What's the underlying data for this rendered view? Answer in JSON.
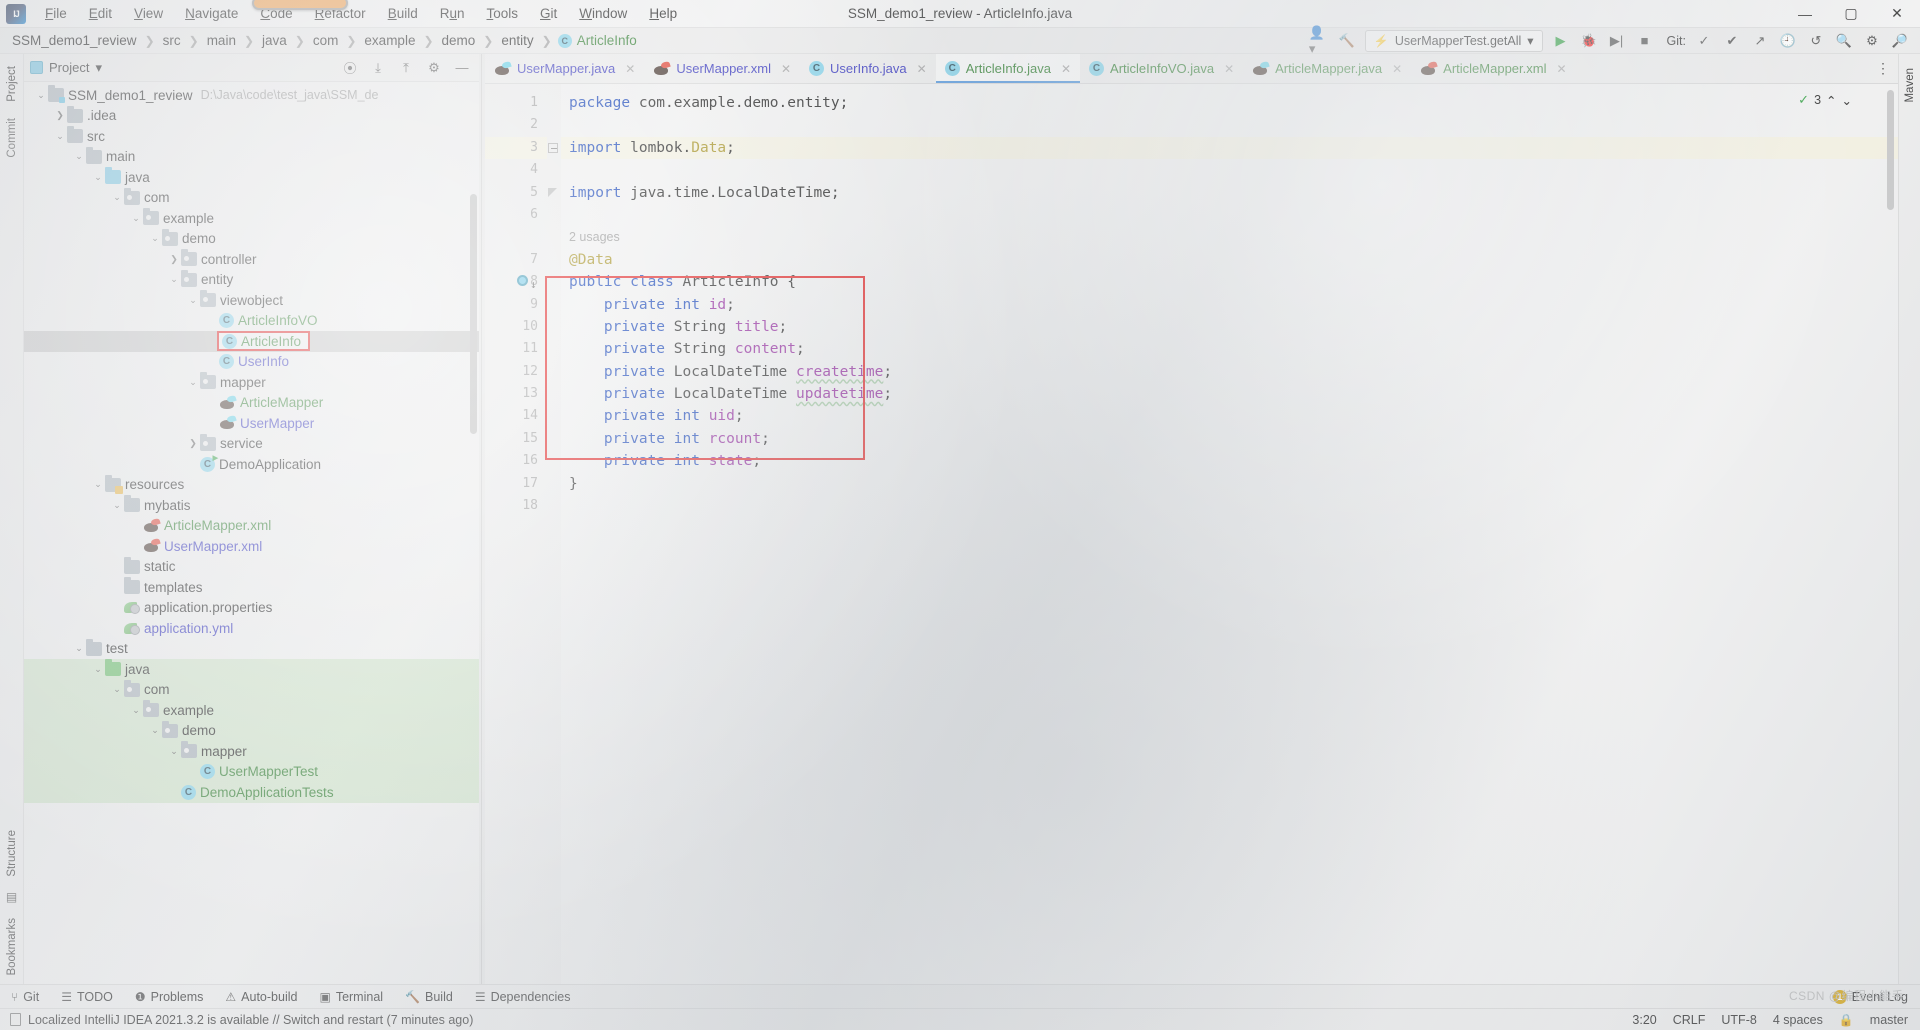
{
  "window": {
    "title": "SSM_demo1_review - ArticleInfo.java",
    "logo_text": "IJ",
    "minimize": "—",
    "maximize": "▢",
    "close": "✕"
  },
  "menu": [
    {
      "label": "File",
      "mnemonic": "F"
    },
    {
      "label": "Edit",
      "mnemonic": "E"
    },
    {
      "label": "View",
      "mnemonic": "V"
    },
    {
      "label": "Navigate",
      "mnemonic": "N"
    },
    {
      "label": "Code",
      "mnemonic": "C"
    },
    {
      "label": "Refactor",
      "mnemonic": "R"
    },
    {
      "label": "Build",
      "mnemonic": "B"
    },
    {
      "label": "Run",
      "mnemonic": "u"
    },
    {
      "label": "Tools",
      "mnemonic": "T"
    },
    {
      "label": "Git",
      "mnemonic": "G"
    },
    {
      "label": "Window",
      "mnemonic": "W"
    },
    {
      "label": "Help",
      "mnemonic": "H"
    }
  ],
  "breadcrumb": {
    "items": [
      "SSM_demo1_review",
      "src",
      "main",
      "java",
      "com",
      "example",
      "demo",
      "entity"
    ],
    "file": "ArticleInfo",
    "separator": "❯"
  },
  "navbar_right": {
    "run_config": "UserMapperTest.getAll",
    "git_label": "Git:",
    "icons": [
      "account-icon",
      "hammer-icon",
      "run-icon",
      "debug-icon",
      "coverage-icon",
      "stop-icon",
      "commit-icon",
      "update-icon",
      "push-icon",
      "history-icon",
      "undo-icon",
      "search-icon",
      "settings-icon",
      "ide-search-icon"
    ]
  },
  "left_rail": {
    "top_tab": "Project",
    "tabs": [
      "Commit",
      "Structure",
      "Bookmarks"
    ]
  },
  "right_rail": {
    "tabs": [
      "Maven"
    ]
  },
  "project_panel": {
    "title": "Project",
    "dropdown": "▾",
    "header_icons": [
      "locate-icon",
      "expand-all-icon",
      "collapse-all-icon",
      "settings-icon",
      "hide-icon"
    ],
    "tree": [
      {
        "depth": 0,
        "arrow": "v",
        "icon": "folder-src",
        "label": "SSM_demo1_review",
        "sub": "D:\\Java\\code\\test_java\\SSM_de",
        "color": "dark",
        "state": "normal"
      },
      {
        "depth": 1,
        "arrow": ">",
        "icon": "folder",
        "label": ".idea",
        "color": "dark",
        "state": "normal"
      },
      {
        "depth": 1,
        "arrow": "v",
        "icon": "folder",
        "label": "src",
        "color": "dark",
        "state": "normal"
      },
      {
        "depth": 2,
        "arrow": "v",
        "icon": "folder",
        "label": "main",
        "color": "dark",
        "state": "normal"
      },
      {
        "depth": 3,
        "arrow": "v",
        "icon": "folder-blue",
        "label": "java",
        "color": "dark",
        "state": "normal"
      },
      {
        "depth": 4,
        "arrow": "v",
        "icon": "folder-pkg",
        "label": "com",
        "color": "dark",
        "state": "normal"
      },
      {
        "depth": 5,
        "arrow": "v",
        "icon": "folder-pkg",
        "label": "example",
        "color": "dark",
        "state": "normal"
      },
      {
        "depth": 6,
        "arrow": "v",
        "icon": "folder-pkg",
        "label": "demo",
        "color": "dark",
        "state": "normal"
      },
      {
        "depth": 7,
        "arrow": ">",
        "icon": "folder-pkg",
        "label": "controller",
        "color": "dark",
        "state": "normal"
      },
      {
        "depth": 7,
        "arrow": "v",
        "icon": "folder-pkg",
        "label": "entity",
        "color": "dark",
        "state": "normal"
      },
      {
        "depth": 8,
        "arrow": "v",
        "icon": "folder-pkg",
        "label": "viewobject",
        "color": "dark",
        "state": "normal"
      },
      {
        "depth": 9,
        "arrow": "",
        "icon": "class",
        "label": "ArticleInfoVO",
        "color": "green",
        "state": "normal"
      },
      {
        "depth": 9,
        "arrow": "",
        "icon": "class",
        "label": "ArticleInfo",
        "color": "green",
        "state": "selected-redbox"
      },
      {
        "depth": 9,
        "arrow": "",
        "icon": "class",
        "label": "UserInfo",
        "color": "blue",
        "state": "normal"
      },
      {
        "depth": 8,
        "arrow": "v",
        "icon": "folder-pkg",
        "label": "mapper",
        "color": "dark",
        "state": "normal"
      },
      {
        "depth": 9,
        "arrow": "",
        "icon": "mybatis",
        "label": "ArticleMapper",
        "color": "green",
        "state": "normal"
      },
      {
        "depth": 9,
        "arrow": "",
        "icon": "mybatis",
        "label": "UserMapper",
        "color": "blue",
        "state": "normal"
      },
      {
        "depth": 8,
        "arrow": ">",
        "icon": "folder-pkg",
        "label": "service",
        "color": "dark",
        "state": "normal"
      },
      {
        "depth": 8,
        "arrow": "",
        "icon": "class-spring",
        "label": "DemoApplication",
        "color": "dark",
        "state": "normal"
      },
      {
        "depth": 3,
        "arrow": "v",
        "icon": "folder-res",
        "label": "resources",
        "color": "dark",
        "state": "normal"
      },
      {
        "depth": 4,
        "arrow": "v",
        "icon": "folder",
        "label": "mybatis",
        "color": "dark",
        "state": "normal"
      },
      {
        "depth": 5,
        "arrow": "",
        "icon": "mybatis-red",
        "label": "ArticleMapper.xml",
        "color": "green",
        "state": "normal"
      },
      {
        "depth": 5,
        "arrow": "",
        "icon": "mybatis-red",
        "label": "UserMapper.xml",
        "color": "blue",
        "state": "normal"
      },
      {
        "depth": 4,
        "arrow": "",
        "icon": "folder",
        "label": "static",
        "color": "dark",
        "state": "normal"
      },
      {
        "depth": 4,
        "arrow": "",
        "icon": "folder",
        "label": "templates",
        "color": "dark",
        "state": "normal"
      },
      {
        "depth": 4,
        "arrow": "",
        "icon": "leaf",
        "label": "application.properties",
        "color": "dark",
        "state": "normal"
      },
      {
        "depth": 4,
        "arrow": "",
        "icon": "leaf",
        "label": "application.yml",
        "color": "blue",
        "state": "normal"
      },
      {
        "depth": 2,
        "arrow": "v",
        "icon": "folder",
        "label": "test",
        "color": "dark",
        "state": "normal"
      },
      {
        "depth": 3,
        "arrow": "v",
        "icon": "folder-green",
        "label": "java",
        "color": "dark",
        "state": "test-highlight"
      },
      {
        "depth": 4,
        "arrow": "v",
        "icon": "folder-pkg",
        "label": "com",
        "color": "dark",
        "state": "test-highlight"
      },
      {
        "depth": 5,
        "arrow": "v",
        "icon": "folder-pkg",
        "label": "example",
        "color": "dark",
        "state": "test-highlight"
      },
      {
        "depth": 6,
        "arrow": "v",
        "icon": "folder-pkg",
        "label": "demo",
        "color": "dark",
        "state": "test-highlight"
      },
      {
        "depth": 7,
        "arrow": "v",
        "icon": "folder-pkg",
        "label": "mapper",
        "color": "dark",
        "state": "test-highlight"
      },
      {
        "depth": 8,
        "arrow": "",
        "icon": "class",
        "label": "UserMapperTest",
        "color": "green",
        "state": "test-highlight"
      },
      {
        "depth": 7,
        "arrow": "",
        "icon": "class",
        "label": "DemoApplicationTests",
        "color": "green",
        "state": "test-highlight"
      }
    ]
  },
  "editor": {
    "tabs": [
      {
        "label": "UserMapper.java",
        "icon": "mybatis",
        "color": "blue",
        "active": false
      },
      {
        "label": "UserMapper.xml",
        "icon": "mybatis-red",
        "color": "blue",
        "active": false
      },
      {
        "label": "UserInfo.java",
        "icon": "class",
        "color": "blue",
        "active": false
      },
      {
        "label": "ArticleInfo.java",
        "icon": "class",
        "color": "green",
        "active": true
      },
      {
        "label": "ArticleInfoVO.java",
        "icon": "class",
        "color": "green",
        "active": false
      },
      {
        "label": "ArticleMapper.java",
        "icon": "mybatis",
        "color": "green",
        "active": false
      },
      {
        "label": "ArticleMapper.xml",
        "icon": "mybatis-red",
        "color": "green",
        "active": false
      }
    ],
    "tab_close": "✕",
    "more_tabs": "⋮",
    "inspection_count": "3",
    "inspection_ok": "✓",
    "lines": [
      {
        "n": "1",
        "text": "package com.example.demo.entity;",
        "type": "package"
      },
      {
        "n": "2",
        "text": "",
        "type": "blank"
      },
      {
        "n": "3",
        "text": "import lombok.Data;",
        "type": "import-lombok",
        "highlight": true,
        "fold": "minus"
      },
      {
        "n": "4",
        "text": "",
        "type": "blank"
      },
      {
        "n": "5",
        "text": "import java.time.LocalDateTime;",
        "type": "import-plain",
        "fold": "tri"
      },
      {
        "n": "6",
        "text": "",
        "type": "blank"
      },
      {
        "n": "",
        "text": "2 usages",
        "type": "usages"
      },
      {
        "n": "7",
        "text": "@Data",
        "type": "annotation"
      },
      {
        "n": "8",
        "text": "public class ArticleInfo {",
        "type": "classdecl",
        "breakpoint": true
      },
      {
        "n": "9",
        "text": "    private int id;",
        "type": "field",
        "mods": "private",
        "ftype": "int",
        "fname": "id"
      },
      {
        "n": "10",
        "text": "    private String title;",
        "type": "field",
        "mods": "private",
        "ftype": "String",
        "fname": "title"
      },
      {
        "n": "11",
        "text": "    private String content;",
        "type": "field",
        "mods": "private",
        "ftype": "String",
        "fname": "content"
      },
      {
        "n": "12",
        "text": "    private LocalDateTime createtime;",
        "type": "field-wavy",
        "mods": "private",
        "ftype": "LocalDateTime",
        "fname": "createtime"
      },
      {
        "n": "13",
        "text": "    private LocalDateTime updatetime;",
        "type": "field-wavy",
        "mods": "private",
        "ftype": "LocalDateTime",
        "fname": "updatetime"
      },
      {
        "n": "14",
        "text": "    private int uid;",
        "type": "field",
        "mods": "private",
        "ftype": "int",
        "fname": "uid"
      },
      {
        "n": "15",
        "text": "    private int rcount;",
        "type": "field",
        "mods": "private",
        "ftype": "int",
        "fname": "rcount"
      },
      {
        "n": "16",
        "text": "    private int state;",
        "type": "field",
        "mods": "private",
        "ftype": "int",
        "fname": "state"
      },
      {
        "n": "17",
        "text": "}",
        "type": "brace"
      },
      {
        "n": "18",
        "text": "",
        "type": "blank"
      }
    ]
  },
  "bottom_tools": [
    {
      "label": "Git",
      "icon": "branch-icon"
    },
    {
      "label": "TODO",
      "icon": "list-icon"
    },
    {
      "label": "Problems",
      "icon": "alert-circle-icon"
    },
    {
      "label": "Auto-build",
      "icon": "warning-triangle-icon"
    },
    {
      "label": "Terminal",
      "icon": "terminal-icon"
    },
    {
      "label": "Build",
      "icon": "hammer-icon"
    },
    {
      "label": "Dependencies",
      "icon": "layers-icon"
    }
  ],
  "bottom_right": {
    "event_log": "Event Log",
    "badge": "1"
  },
  "statusbar": {
    "message": "Localized IntelliJ IDEA 2021.3.2 is available // Switch and restart (7 minutes ago)",
    "caret": "3:20",
    "line_sep": "CRLF",
    "encoding": "UTF-8",
    "indent": "4 spaces",
    "lock": "🔒",
    "branch": "master"
  },
  "watermark": "CSDN @编程小能手",
  "colors": {
    "accent": "#4a90d9",
    "redbox": "#e01010",
    "keyword": "#0033b3",
    "field": "#871094",
    "annotation": "#9e880d",
    "green_file": "#2a7a2a",
    "blue_file": "#2b2bbb"
  }
}
